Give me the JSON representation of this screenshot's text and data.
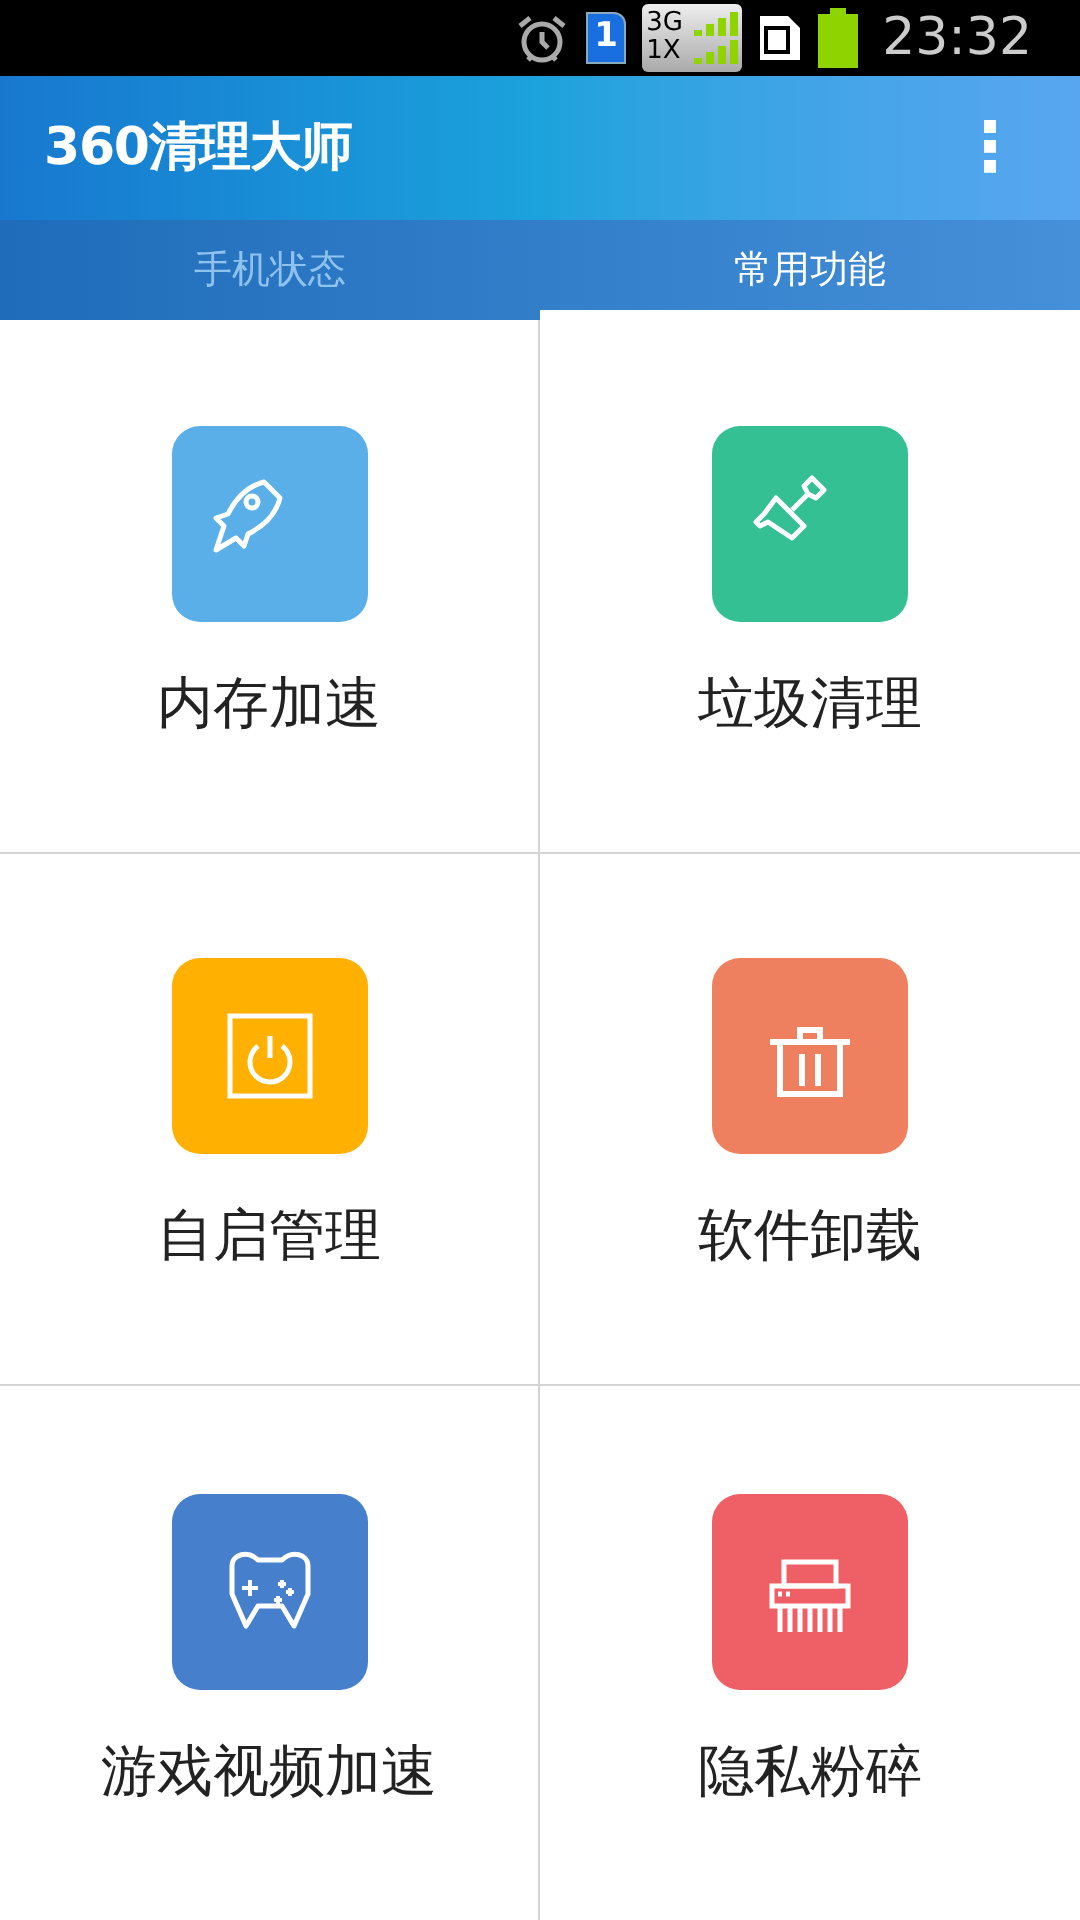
{
  "status_bar": {
    "sim": "1",
    "network_top": "3G",
    "network_bottom": "1X",
    "time": "23:32"
  },
  "app_bar": {
    "title": "360清理大师",
    "menu": "⋮"
  },
  "tabs": [
    {
      "label": "手机状态",
      "selected": false
    },
    {
      "label": "常用功能",
      "selected": true
    }
  ],
  "features": [
    {
      "label": "内存加速",
      "color": "#5aafe8"
    },
    {
      "label": "垃圾清理",
      "color": "#34c093"
    },
    {
      "label": "自启管理",
      "color": "#ffb000"
    },
    {
      "label": "软件卸载",
      "color": "#ee8060"
    },
    {
      "label": "游戏视频加速",
      "color": "#467fcc"
    },
    {
      "label": "隐私粉碎",
      "color": "#ee5f66"
    }
  ]
}
